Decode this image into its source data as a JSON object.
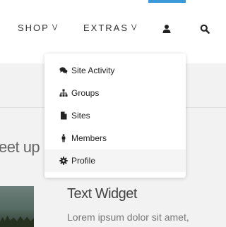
{
  "colors": {
    "accent": "#3a9ad9",
    "band_background": "#f2f2f2",
    "menu_background": "#ffffff",
    "menu_hover": "#f5f5f5",
    "text_dark": "#222222"
  },
  "nav": {
    "items": [
      {
        "label": "SHOP",
        "icon": "chevron-double-down-icon"
      },
      {
        "label": "EXTRAS",
        "icon": "chevron-double-down-icon"
      }
    ],
    "user_icon": "user-icon",
    "search_icon": "search-icon"
  },
  "dropdown": {
    "items": [
      {
        "label": "Site Activity",
        "icon": "comments-icon"
      },
      {
        "label": "Groups",
        "icon": "sitemap-icon"
      },
      {
        "label": "Sites",
        "icon": "file-icon"
      },
      {
        "label": "Members",
        "icon": "person-icon"
      },
      {
        "label": "Profile",
        "icon": "gear-icon",
        "highlighted": true
      }
    ]
  },
  "content": {
    "heading_fragment": "eet up",
    "widget_title": "Text Widget",
    "widget_body": "Lorem ipsum dolor sit amet,"
  }
}
